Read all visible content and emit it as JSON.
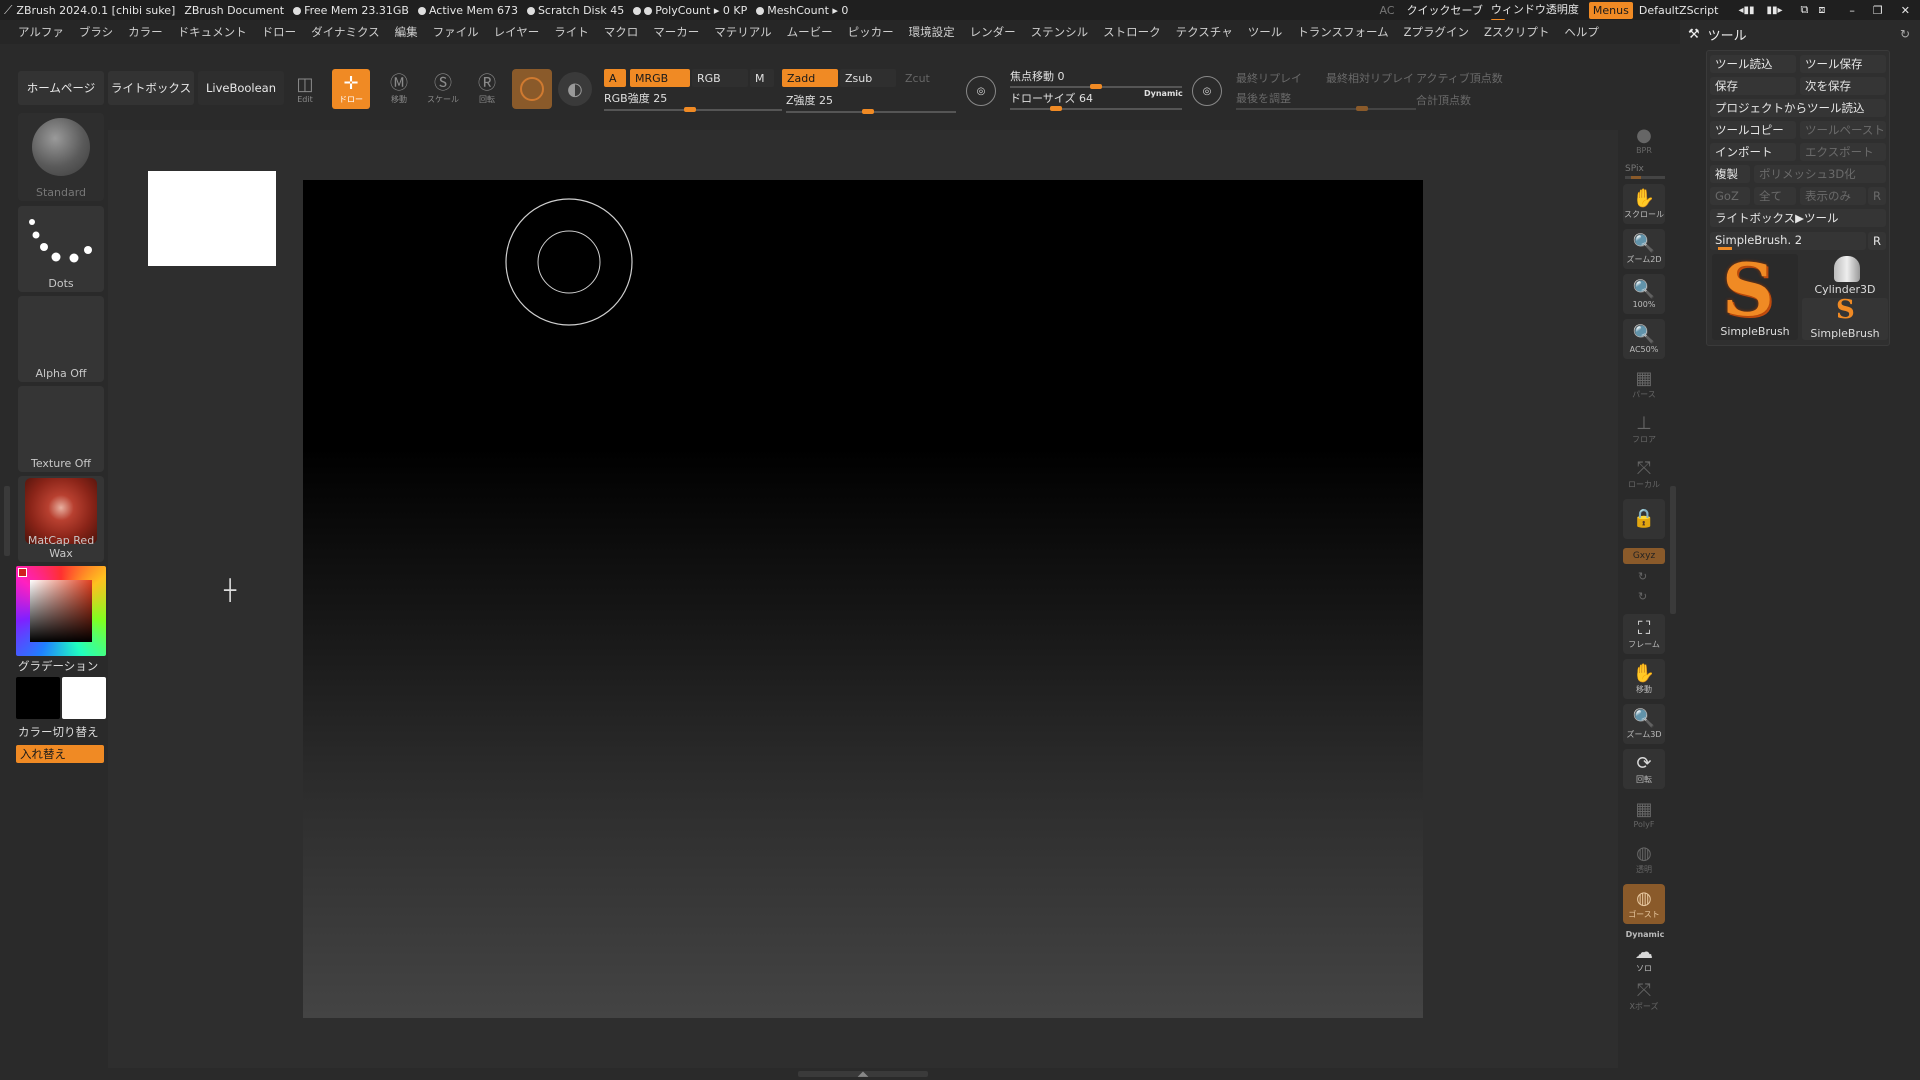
{
  "titlebar": {
    "app": "ZBrush 2024.0.1 [chibi suke]",
    "document": "ZBrush Document",
    "stats": [
      "Free Mem 23.31GB",
      "Active Mem 673",
      "Scratch Disk 45",
      "PolyCount ▸ 0 KP",
      "MeshCount ▸ 0"
    ],
    "ac": "AC",
    "quicksave": "クイックセーブ",
    "transparency": "ウィンドウ透明度",
    "menus": "Menus",
    "script": "DefaultZScript"
  },
  "menubar": [
    "アルファ",
    "ブラシ",
    "カラー",
    "ドキュメント",
    "ドロー",
    "ダイナミクス",
    "編集",
    "ファイル",
    "レイヤー",
    "ライト",
    "マクロ",
    "マーカー",
    "マテリアル",
    "ムービー",
    "ピッカー",
    "環境設定",
    "レンダー",
    "ステンシル",
    "ストローク",
    "テクスチャ",
    "ツール",
    "トランスフォーム",
    "Zプラグイン",
    "Zスクリプト",
    "ヘルプ"
  ],
  "toolbar": {
    "home": "ホームページ",
    "lightbox": "ライトボックス",
    "liveboolean": "LiveBoolean",
    "edit": "Edit",
    "draw": "ドロー",
    "move": "移動",
    "scale": "スケール",
    "rotate": "回転",
    "a": "A",
    "mrgb": "MRGB",
    "rgb": "RGB",
    "m": "M",
    "zadd": "Zadd",
    "zsub": "Zsub",
    "zcut": "Zcut",
    "rgb_intensity": "RGB強度 25",
    "rgb_intensity_value": 25,
    "z_intensity": "Z強度 25",
    "z_intensity_value": 25,
    "focal_shift": "焦点移動 0",
    "focal_shift_value": 0,
    "draw_size": "ドローサイズ 64",
    "draw_size_value": 64,
    "dynamic": "Dynamic",
    "last_replay": "最終リプレイ",
    "last_relative_replay": "最終相対リプレイ",
    "active_points": "アクティブ頂点数",
    "adjust_last": "最後を調整",
    "total_points": "合計頂点数"
  },
  "left": {
    "brush": "Standard",
    "stroke": "Dots",
    "alpha": "Alpha Off",
    "texture": "Texture Off",
    "material": "MatCap Red Wax",
    "gradient": "グラデーション",
    "switch_color": "カラー切り替え",
    "swap": "入れ替え"
  },
  "right_shelf": {
    "bpr": "BPR",
    "spix": "SPix",
    "scroll": "スクロール",
    "zoom2d": "ズーム2D",
    "actual": "100%",
    "aahalf": "AC50%",
    "persp": "パース",
    "floor": "フロア",
    "local": "ローカル",
    "xyz": "Gxyz",
    "frame": "フレーム",
    "move": "移動",
    "zoom3d": "ズーム3D",
    "rotate": "回転",
    "polyf": "PolyF",
    "transp": "透明",
    "ghost": "ゴースト",
    "dynamic": "Dynamic",
    "solo": "ソロ",
    "xpose": "Xポーズ"
  },
  "tool_panel": {
    "title": "ツール",
    "load_tool": "ツール読込",
    "save_tool": "ツール保存",
    "save": "保存",
    "save_as": "次を保存",
    "load_from_project": "プロジェクトからツール読込",
    "copy_tool": "ツールコピー",
    "paste_tool": "ツールペースト",
    "import": "インポート",
    "export": "エクスポート",
    "clone": "複製",
    "make_polymesh": "ポリメッシュ3D化",
    "goz": "GoZ",
    "all": "全て",
    "visible": "表示のみ",
    "r": "R",
    "lightbox_tool": "ライトボックス▶ツール",
    "current_tool": "SimpleBrush. 2",
    "tools": [
      "SimpleBrush",
      "Cylinder3D",
      "SimpleBrush"
    ]
  },
  "colors": {
    "accent": "#f08a24",
    "bg": "#2a2a2a"
  }
}
